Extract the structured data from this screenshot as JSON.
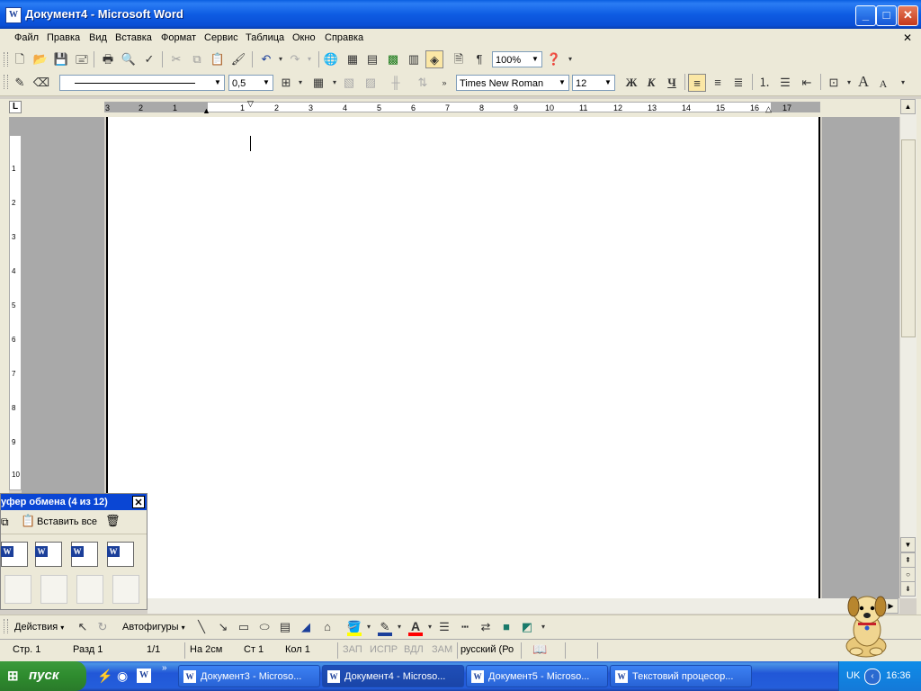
{
  "window": {
    "title": "Документ4 - Microsoft Word",
    "app_icon": "W"
  },
  "menu": [
    "Файл",
    "Правка",
    "Вид",
    "Вставка",
    "Формат",
    "Сервис",
    "Таблица",
    "Окно",
    "Справка"
  ],
  "standard_toolbar": {
    "zoom": "100%"
  },
  "tables_toolbar": {
    "line_weight": "0,5"
  },
  "formatting_toolbar": {
    "font": "Times New Roman",
    "size": "12",
    "bold": "Ж",
    "italic": "К",
    "underline": "Ч",
    "font_letter": "A"
  },
  "ruler": {
    "left_numbers": [
      "3",
      "2",
      "1"
    ],
    "numbers": [
      "1",
      "2",
      "3",
      "4",
      "5",
      "6",
      "7",
      "8",
      "9",
      "10",
      "11",
      "12",
      "13",
      "14",
      "15",
      "16",
      "17"
    ],
    "vertical_numbers": [
      "1",
      "2",
      "3",
      "4",
      "5",
      "6",
      "7",
      "8",
      "9",
      "10"
    ],
    "corner": "L"
  },
  "clipboard": {
    "title": "уфер обмена (4 из 12)",
    "paste_all": "Вставить все",
    "icon_letter": "W"
  },
  "drawing_toolbar": {
    "actions": "Действия",
    "autoshapes": "Автофигуры",
    "text_color_letter": "A"
  },
  "status": {
    "page": "Стр. 1",
    "section": "Разд 1",
    "pages": "1/1",
    "at": "На 2см",
    "line": "Ст 1",
    "col": "Кол 1",
    "rec": "ЗАП",
    "trk": "ИСПР",
    "ext": "ВДЛ",
    "ovr": "ЗАМ",
    "lang": "русский (Ро"
  },
  "taskbar": {
    "start": "пуск",
    "tasks": [
      "Документ3 - Microso...",
      "Документ4 - Microso...",
      "Документ5 - Microso...",
      "Текстовий процесор..."
    ],
    "task_icon": "W",
    "lang": "UK",
    "time": "16:36"
  },
  "colors": {
    "titlebar": "#0A5FE0",
    "taskbar": "#245EDB",
    "start": "#2E8B2E",
    "highlight": "#FFFF00",
    "font_color": "#FF0000"
  }
}
